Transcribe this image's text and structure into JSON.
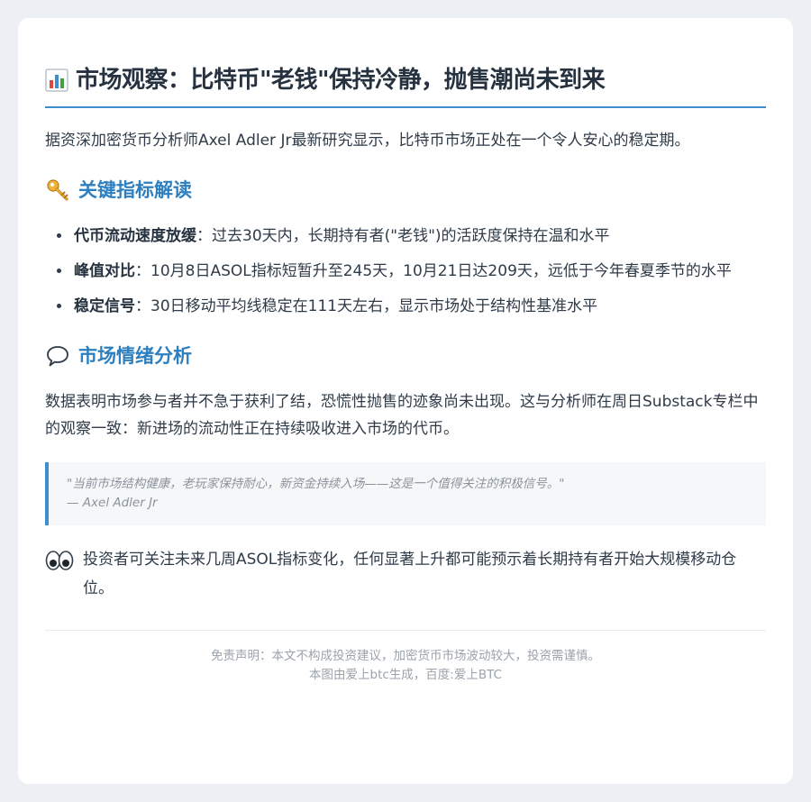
{
  "header": {
    "title": "市场观察：比特币\"老钱\"保持冷静，抛售潮尚未到来",
    "icon": "bar-chart-icon"
  },
  "intro": "据资深加密货币分析师Axel Adler Jr最新研究显示，比特币市场正处在一个令人安心的稳定期。",
  "sections": {
    "indicators": {
      "icon": "key-icon",
      "title": "关键指标解读",
      "items": [
        {
          "label": "代币流动速度放缓",
          "sep": "：",
          "text": "过去30天内，长期持有者(\"老钱\")的活跃度保持在温和水平"
        },
        {
          "label": "峰值对比",
          "sep": "：",
          "text": "10月8日ASOL指标短暂升至245天，10月21日达209天，远低于今年春夏季节的水平"
        },
        {
          "label": "稳定信号",
          "sep": "：",
          "text": "30日移动平均线稳定在111天左右，显示市场处于结构性基准水平"
        }
      ]
    },
    "sentiment": {
      "icon": "speech-bubble-icon",
      "title": "市场情绪分析",
      "text": "数据表明市场参与者并不急于获利了结，恐慌性抛售的迹象尚未出现。这与分析师在周日Substack专栏中的观察一致：新进场的流动性正在持续吸收进入市场的代币。"
    }
  },
  "quote": {
    "text": "\"当前市场结构健康，老玩家保持耐心，新资金持续入场——这是一个值得关注的积极信号。\"",
    "author": "— Axel Adler Jr"
  },
  "advice": {
    "icon": "eyes-icon",
    "text": "投资者可关注未来几周ASOL指标变化，任何显著上升都可能预示着长期持有者开始大规模移动仓位。"
  },
  "footer": {
    "disclaimer": "免责声明：本文不构成投资建议，加密货币市场波动较大，投资需谨慎。",
    "credit": "本图由爱上btc生成，百度:爱上BTC"
  },
  "colors": {
    "accent": "#3a8fce",
    "heading": "#2d7fbf",
    "text": "#2f3b48",
    "muted": "#9aa2aa",
    "background": "#eceff3"
  }
}
